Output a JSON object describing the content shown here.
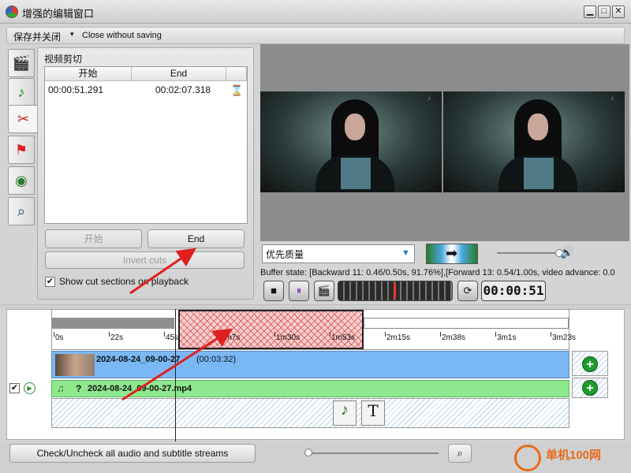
{
  "window": {
    "title": "增强的编辑窗口",
    "app_icon": "app-icon",
    "controls": [
      "minimize-icon",
      "maximize-icon",
      "close-icon"
    ]
  },
  "toolbar": {
    "save_close_label": "保存并关闭",
    "dropdown_glyph": "▾",
    "close_without_saving_label": "Close without saving"
  },
  "side_tabs": [
    {
      "name": "video-tab",
      "icon": "clapperboard-icon"
    },
    {
      "name": "audio-tab",
      "icon": "music-note-icon"
    },
    {
      "name": "cut-tab",
      "icon": "scissors-icon"
    },
    {
      "name": "chapters-tab",
      "icon": "flag-icon"
    },
    {
      "name": "effects-tab",
      "icon": "palette-icon"
    },
    {
      "name": "preview-tab",
      "icon": "magnifier-icon"
    }
  ],
  "cut_panel": {
    "title": "视频剪切",
    "columns": [
      "开始",
      "End"
    ],
    "rows": [
      {
        "start": "00:00:51.291",
        "end": "00:02:07.318"
      }
    ],
    "start_button": "开始",
    "end_button": "End",
    "invert_button": "Invert cuts",
    "show_cut_label": "Show cut sections on playback",
    "show_cut_checked": "✔"
  },
  "preview": {
    "quality_value": "优先质量",
    "buffer_state": "Buffer state: [Backward 11: 0.46/0.50s, 91.76%],[Forward  13: 0.54/1.00s, video advance: 0.0",
    "time_display": "00:00:51",
    "frame_logo": "♪",
    "volume_level": 0.95
  },
  "timeline": {
    "ticks": [
      "0s",
      "22s",
      "45s",
      "1m7s",
      "1m30s",
      "1m53s",
      "2m15s",
      "2m38s",
      "3m1s",
      "3m23s"
    ],
    "video_track_name": "2024-08-24_09-00-27",
    "video_track_duration": "(00:03:32)",
    "audio_track_q": "?",
    "audio_track_name": "2024-08-24_09-00-27.mp4",
    "row_checked": "✔",
    "cut_region": {
      "start": "00:00:51.291",
      "end": "00:02:07.318"
    }
  },
  "bottom": {
    "check_all_label": "Check/Uncheck all audio and subtitle streams",
    "zoom_level": 0.0
  },
  "watermark": "单机100网",
  "colors": {
    "video_track": "#7ab8f5",
    "audio_track": "#8ee88e",
    "cut_region": "#e02828",
    "arrow": "#e02020"
  }
}
